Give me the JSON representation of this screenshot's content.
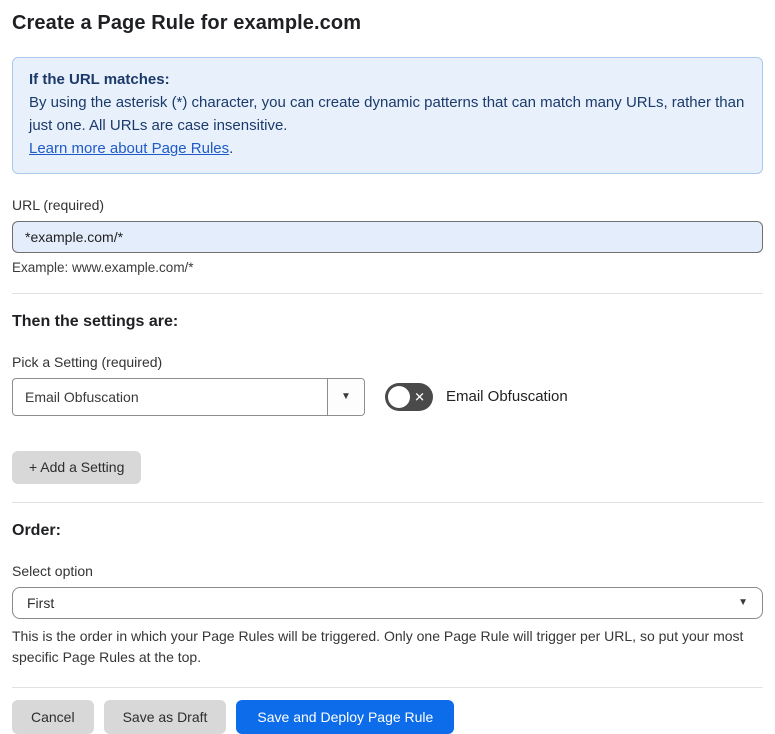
{
  "page": {
    "title": "Create a Page Rule for example.com"
  },
  "info_box": {
    "heading": "If the URL matches:",
    "body": "By using the asterisk (*) character, you can create dynamic patterns that can match many URLs, rather than just one. All URLs are case insensitive.",
    "link_label": "Learn more about Page Rules",
    "link_suffix": "."
  },
  "url_field": {
    "label": "URL (required)",
    "value": "*example.com/*",
    "helper": "Example: www.example.com/*"
  },
  "settings_section": {
    "heading": "Then the settings are:",
    "picker_label": "Pick a Setting (required)",
    "picker_value": "Email Obfuscation",
    "toggle_state": "off",
    "toggle_x_glyph": "✕",
    "toggle_label": "Email Obfuscation",
    "add_setting_label": "+ Add a Setting"
  },
  "order_section": {
    "heading": "Order:",
    "select_label": "Select option",
    "select_value": "First",
    "helper": "This is the order in which your Page Rules will be triggered. Only one Page Rule will trigger per URL, so put your most specific Page Rules at the top."
  },
  "footer": {
    "cancel_label": "Cancel",
    "save_draft_label": "Save as Draft",
    "save_deploy_label": "Save and Deploy Page Rule"
  },
  "icons": {
    "dropdown_caret": "▼"
  },
  "colors": {
    "accent_blue": "#0d6ce9",
    "info_bg": "#e8f1fb",
    "info_border": "#abc9ec",
    "info_text": "#1b3a6b",
    "link_blue": "#1f5ac8",
    "input_bg": "#e4edfb",
    "toggle_off_bg": "#4a4a4a",
    "gray_button_bg": "#d8d8d8"
  }
}
